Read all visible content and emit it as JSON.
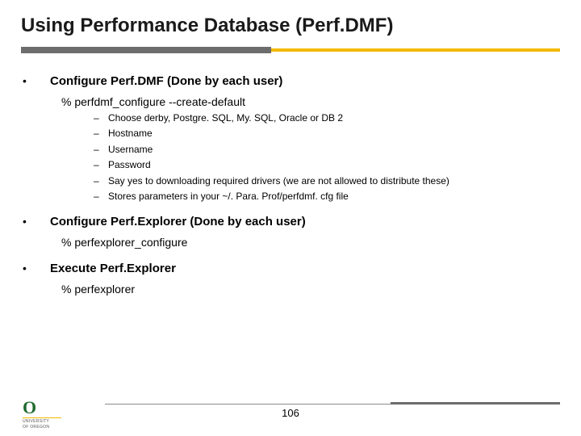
{
  "title": "Using Performance Database (Perf.DMF)",
  "sections": [
    {
      "heading": "Configure Perf.DMF (Done by each user)",
      "command": "% perfdmf_configure --create-default",
      "sub": [
        "Choose derby, Postgre. SQL, My. SQL, Oracle or DB 2",
        "Hostname",
        "Username",
        "Password",
        "Say yes to downloading required drivers (we are not allowed to distribute these)",
        "Stores parameters in your ~/. Para. Prof/perfdmf. cfg file"
      ]
    },
    {
      "heading": "Configure Perf.Explorer (Done by each user)",
      "command": "% perfexplorer_configure",
      "sub": []
    },
    {
      "heading": "Execute Perf.Explorer",
      "command": "% perfexplorer",
      "sub": []
    }
  ],
  "page_number": "106",
  "logo": {
    "mark": "O",
    "line1": "UNIVERSITY",
    "line2": "OF OREGON"
  }
}
